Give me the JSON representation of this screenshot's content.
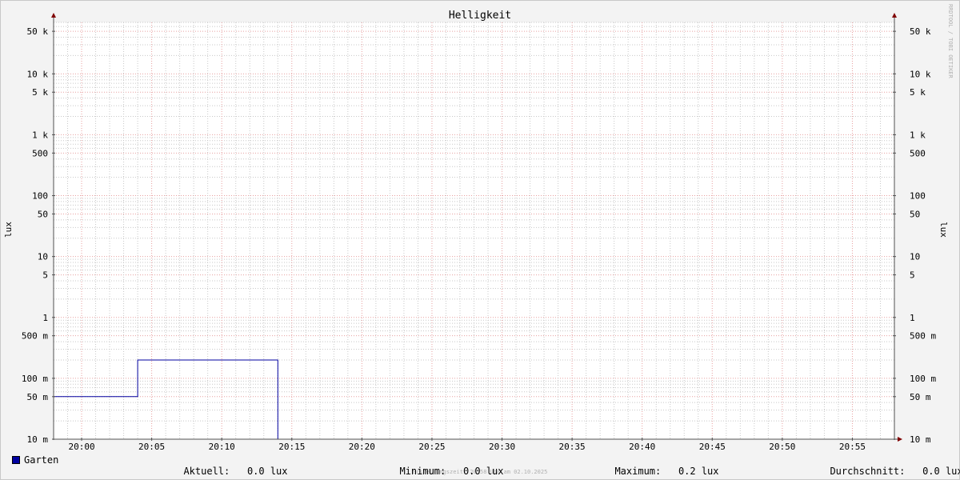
{
  "chart_data": {
    "type": "line",
    "title": "Helligkeit",
    "ylabel": "lux",
    "ylabel_right": "lux",
    "yscale": "log",
    "ylim": [
      0.01,
      70000
    ],
    "x_time_range": [
      "19:58",
      "20:58"
    ],
    "x_tick_labels": [
      "20:00",
      "20:05",
      "20:10",
      "20:15",
      "20:20",
      "20:25",
      "20:30",
      "20:35",
      "20:40",
      "20:45",
      "20:50",
      "20:55"
    ],
    "y_ticks": [
      {
        "value": 50000,
        "label": "50 k"
      },
      {
        "value": 10000,
        "label": "10 k"
      },
      {
        "value": 5000,
        "label": "5 k"
      },
      {
        "value": 1000,
        "label": "1 k"
      },
      {
        "value": 500,
        "label": "500"
      },
      {
        "value": 100,
        "label": "100"
      },
      {
        "value": 50,
        "label": "50"
      },
      {
        "value": 10,
        "label": "10"
      },
      {
        "value": 5,
        "label": "5"
      },
      {
        "value": 1,
        "label": "1"
      },
      {
        "value": 0.5,
        "label": "500 m"
      },
      {
        "value": 0.1,
        "label": "100 m"
      },
      {
        "value": 0.05,
        "label": "50 m"
      },
      {
        "value": 0.01,
        "label": "10 m"
      }
    ],
    "series": [
      {
        "name": "Garten",
        "color": "#0000a0",
        "points": [
          {
            "x": "19:58",
            "y": 0.05
          },
          {
            "x": "20:04",
            "y": 0.05
          },
          {
            "x": "20:04",
            "y": 0.2
          },
          {
            "x": "20:14",
            "y": 0.2
          },
          {
            "x": "20:14",
            "y": 0.01
          },
          {
            "x": "20:58",
            "y": 0.01
          }
        ]
      }
    ],
    "grid": true,
    "legend_position": "bottom"
  },
  "legend": {
    "series_name": "Garten",
    "current_label": "Aktuell:",
    "current_value": "0.0 lux",
    "min_label": "Minimum:",
    "min_value": "0.0 lux",
    "max_label": "Maximum:",
    "max_value": "0.2 lux",
    "avg_label": "Durchschnitt:",
    "avg_value": "0.0 lux"
  },
  "footer": "Erstellungszeit: 20:58 Uhr am 02.10.2025",
  "watermark": "RRDTOOL / TOBI OETIKER",
  "colors": {
    "background": "#f3f3f3",
    "plot_background": "#ffffff",
    "major_grid": "#e8a0a0",
    "minor_grid": "#c8c8c8",
    "axis": "#505050",
    "arrow": "#800000",
    "series": "#0000a0"
  }
}
